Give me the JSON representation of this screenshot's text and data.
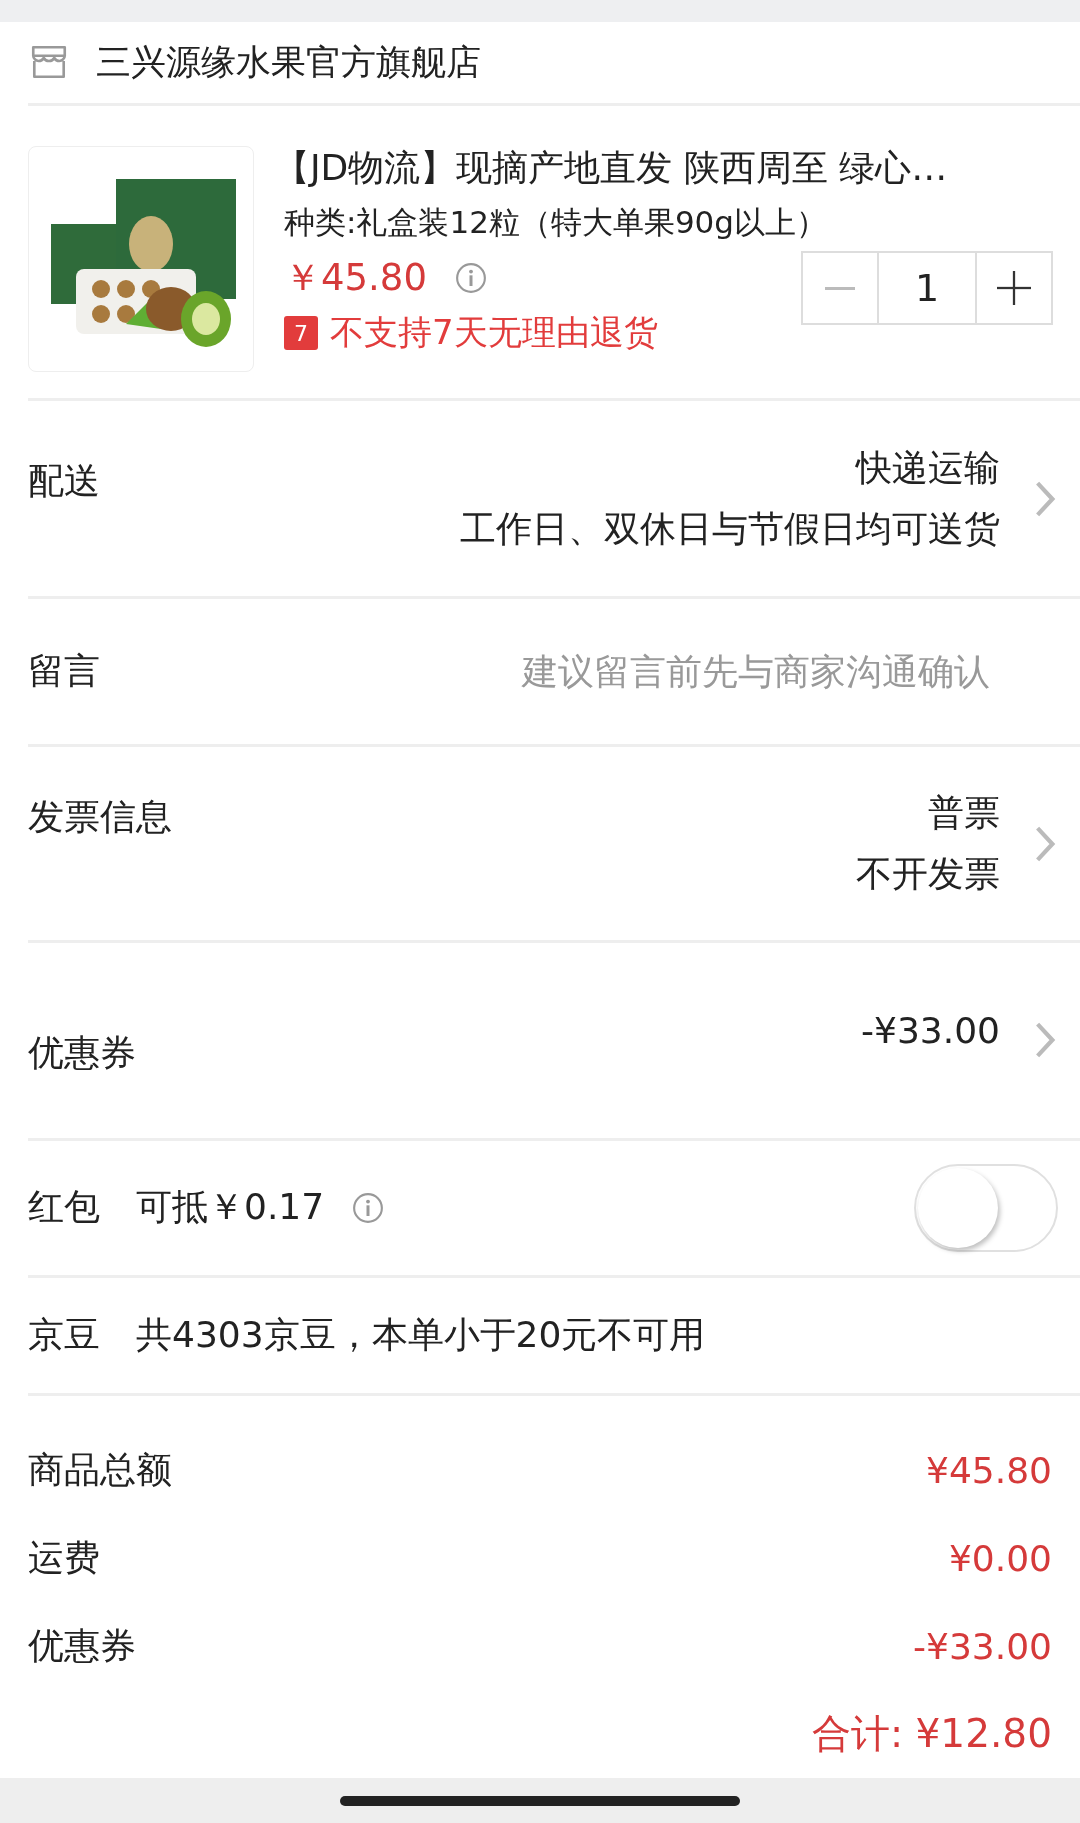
{
  "store": {
    "name": "三兴源缘水果官方旗舰店"
  },
  "product": {
    "title": "【JD物流】现摘产地直发 陕西周至 绿心…",
    "spec": "种类:礼盒装12粒（特大单果90g以上）",
    "price": "￥45.80",
    "quantity": "1",
    "return_badge": "7",
    "return_policy": "不支持7天无理由退货"
  },
  "delivery": {
    "label": "配送",
    "method": "快递运输",
    "schedule": "工作日、双休日与节假日均可送货"
  },
  "message": {
    "label": "留言",
    "placeholder": "建议留言前先与商家沟通确认"
  },
  "invoice": {
    "label": "发票信息",
    "type": "普票",
    "detail": "不开发票"
  },
  "coupon": {
    "label": "优惠券",
    "value": "-¥33.00"
  },
  "red_packet": {
    "label": "红包",
    "deduct": "可抵￥0.17",
    "on": false
  },
  "jingdou": {
    "label": "京豆",
    "note": "共4303京豆，本单小于20元不可用"
  },
  "summary": {
    "rows": [
      {
        "label": "商品总额",
        "value": "¥45.80"
      },
      {
        "label": "运费",
        "value": "¥0.00"
      },
      {
        "label": "优惠券",
        "value": "-¥33.00"
      }
    ],
    "total": "合计: ¥12.80"
  }
}
